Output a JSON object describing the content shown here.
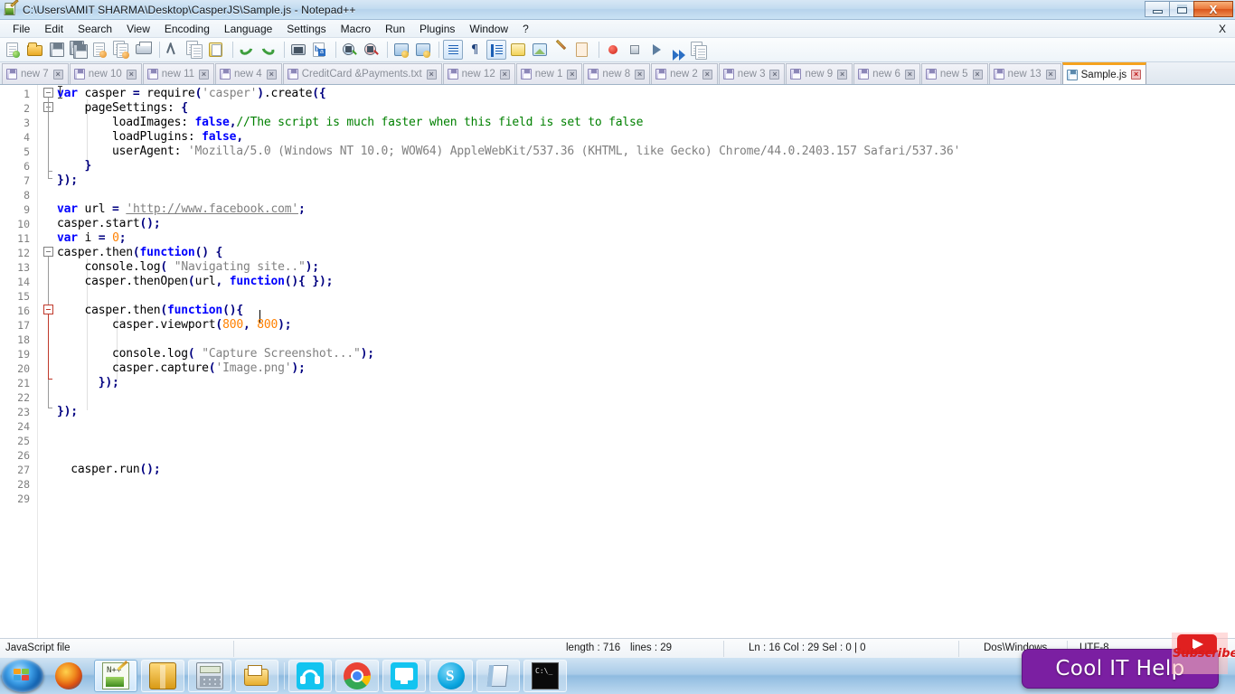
{
  "window": {
    "title": "C:\\Users\\AMIT SHARMA\\Desktop\\CasperJS\\Sample.js - Notepad++",
    "app_icon": "notepad-plus-plus-icon",
    "controls": {
      "minimize": "–",
      "restore": "❐",
      "close": "X"
    }
  },
  "menu": {
    "items": [
      "File",
      "Edit",
      "Search",
      "View",
      "Encoding",
      "Language",
      "Settings",
      "Macro",
      "Run",
      "Plugins",
      "Window",
      "?"
    ],
    "close_doc": "X"
  },
  "toolbar": {
    "buttons": [
      "new-file-icon",
      "open-file-icon",
      "save-icon",
      "save-all-icon",
      "close-file-icon",
      "close-all-icon",
      "print-icon",
      "cut-icon",
      "copy-icon",
      "paste-icon",
      "undo-icon",
      "redo-icon",
      "find-icon",
      "replace-icon",
      "zoom-in-icon",
      "zoom-out-icon",
      "sync-vertical-icon",
      "sync-horizontal-icon",
      "word-wrap-icon",
      "show-all-chars-icon",
      "indent-guide-icon",
      "show-ui-icon",
      "user-define-dialog-icon",
      "document-map-icon",
      "function-list-icon",
      "folder-as-workspace-icon",
      "record-macro-icon",
      "stop-recording-icon",
      "play-macro-icon",
      "run-macro-multiple-icon",
      "save-macro-icon"
    ]
  },
  "tabs": {
    "items": [
      {
        "label": "new 7",
        "active": false
      },
      {
        "label": "new 10",
        "active": false
      },
      {
        "label": "new 11",
        "active": false
      },
      {
        "label": "new 4",
        "active": false
      },
      {
        "label": "CreditCard &Payments.txt",
        "active": false
      },
      {
        "label": "new 12",
        "active": false
      },
      {
        "label": "new 1",
        "active": false
      },
      {
        "label": "new 8",
        "active": false
      },
      {
        "label": "new 2",
        "active": false
      },
      {
        "label": "new 3",
        "active": false
      },
      {
        "label": "new 9",
        "active": false
      },
      {
        "label": "new 6",
        "active": false
      },
      {
        "label": "new 5",
        "active": false
      },
      {
        "label": "new 13",
        "active": false
      },
      {
        "label": "Sample.js",
        "active": true
      }
    ],
    "close_glyph": "×",
    "active_accent": "#f5a21e"
  },
  "editor": {
    "total_lines": 29,
    "line_numbers": [
      1,
      2,
      3,
      4,
      5,
      6,
      7,
      8,
      9,
      10,
      11,
      12,
      13,
      14,
      15,
      16,
      17,
      18,
      19,
      20,
      21,
      22,
      23,
      24,
      25,
      26,
      27,
      28,
      29
    ],
    "lines": [
      {
        "n": 1,
        "text": "var casper = require('casper').create({"
      },
      {
        "n": 2,
        "text": "    pageSettings: {"
      },
      {
        "n": 3,
        "text": "        loadImages: false,//The script is much faster when this field is set to false"
      },
      {
        "n": 4,
        "text": "        loadPlugins: false,"
      },
      {
        "n": 5,
        "text": "        userAgent: 'Mozilla/5.0 (Windows NT 10.0; WOW64) AppleWebKit/537.36 (KHTML, like Gecko) Chrome/44.0.2403.157 Safari/537.36'"
      },
      {
        "n": 6,
        "text": "    }"
      },
      {
        "n": 7,
        "text": "});"
      },
      {
        "n": 8,
        "text": ""
      },
      {
        "n": 9,
        "text": "var url = 'http://www.facebook.com';"
      },
      {
        "n": 10,
        "text": "casper.start();"
      },
      {
        "n": 11,
        "text": "var i = 0;"
      },
      {
        "n": 12,
        "text": "casper.then(function() {"
      },
      {
        "n": 13,
        "text": "    console.log( \"Navigating site..\");"
      },
      {
        "n": 14,
        "text": "    casper.thenOpen(url, function(){ });"
      },
      {
        "n": 15,
        "text": ""
      },
      {
        "n": 16,
        "text": "    casper.then(function(){ "
      },
      {
        "n": 17,
        "text": "        casper.viewport(800, 800);"
      },
      {
        "n": 18,
        "text": ""
      },
      {
        "n": 19,
        "text": "        console.log( \"Capture Screenshot...\");"
      },
      {
        "n": 20,
        "text": "        casper.capture('Image.png');"
      },
      {
        "n": 21,
        "text": "      });"
      },
      {
        "n": 22,
        "text": ""
      },
      {
        "n": 23,
        "text": "});"
      },
      {
        "n": 24,
        "text": ""
      },
      {
        "n": 25,
        "text": ""
      },
      {
        "n": 26,
        "text": ""
      },
      {
        "n": 27,
        "text": "  casper.run();"
      },
      {
        "n": 28,
        "text": ""
      },
      {
        "n": 29,
        "text": ""
      }
    ],
    "colors": {
      "keyword": "#0000ff",
      "string": "#808080",
      "comment": "#008000",
      "number": "#ff8000",
      "operator": "#000080",
      "text": "#000000",
      "background": "#ffffff",
      "line_number": "#808080"
    }
  },
  "statusbar": {
    "file_type": "JavaScript file",
    "length": "length : 716",
    "lines": "lines : 29",
    "position": "Ln : 16   Col : 29   Sel : 0 | 0",
    "eol": "Dos\\Windows",
    "encoding": "UTF-8"
  },
  "taskbar": {
    "start": "start-orb",
    "items": [
      {
        "name": "firefox-icon",
        "state": "pinned"
      },
      {
        "name": "notepad-plus-plus-icon",
        "state": "active"
      },
      {
        "name": "winrar-icon",
        "state": "pinned"
      },
      {
        "name": "calculator-icon",
        "state": "pinned"
      },
      {
        "name": "file-explorer-icon",
        "state": "pinned"
      },
      {
        "name": "media-player-icon",
        "state": "pinned"
      },
      {
        "name": "chrome-icon",
        "state": "pinned"
      },
      {
        "name": "remote-desktop-icon",
        "state": "pinned"
      },
      {
        "name": "skype-icon",
        "state": "pinned"
      },
      {
        "name": "notepad-icon",
        "state": "pinned"
      },
      {
        "name": "command-prompt-icon",
        "state": "pinned"
      }
    ]
  },
  "watermark": {
    "text": "Cool IT Help",
    "background": "#7b1fa2",
    "subscribe_text": "Subscribe",
    "subscribe_color": "#e02020"
  }
}
